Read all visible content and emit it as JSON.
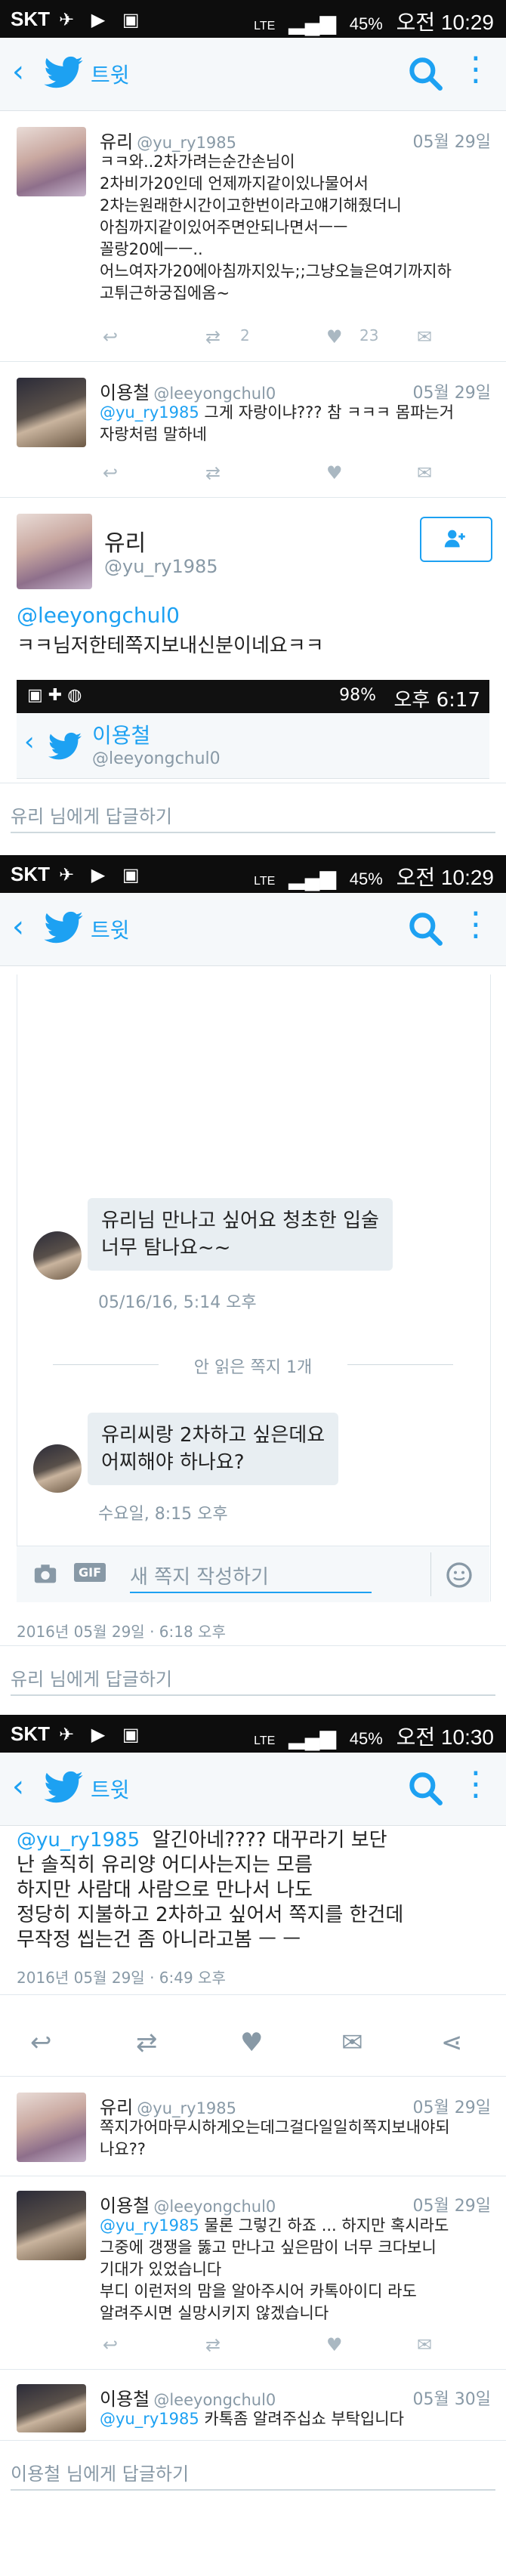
{
  "status1": {
    "carrier": "SKT",
    "battery": "45%",
    "time": "오전 10:29",
    "network": "LTE"
  },
  "status2": {
    "carrier": "SKT",
    "battery": "45%",
    "time": "오전 10:29",
    "network": "LTE"
  },
  "status3": {
    "carrier": "SKT",
    "battery": "45%",
    "time": "오전 10:30",
    "network": "LTE"
  },
  "inner_status": {
    "battery": "98%",
    "time": "오후 6:17"
  },
  "appbar": {
    "title": "트윗"
  },
  "sec1": {
    "tweet1": {
      "name": "유리",
      "handle": "@yu_ry1985",
      "date": "05월 29일",
      "text": "ㅋㅋ와..2차가려는순간손님이\n2차비가20인데 언제까지같이있나물어서\n2차는원래한시간이고한번이라고얘기해줬더니\n아침까지같이있어주면안되나면서ㅡㅡ\n꼴랑20에ㅡㅡ..\n어느여자가20에아침까지있누;;그냥오늘은여기까지하\n고튀근하궁집에옴~",
      "retweets": "2",
      "likes": "23"
    },
    "tweet2": {
      "name": "이용철",
      "handle": "@leeyongchul0",
      "date": "05월 29일",
      "text_mention": "@yu_ry1985",
      "text": " 그게 자랑이냐??? 참 ㅋㅋㅋ 몸파는거\n자랑처럼 말하네"
    },
    "dm_header": {
      "name": "유리",
      "handle": "@yu_ry1985"
    },
    "dm": {
      "mention": "@leeyongchul0",
      "text": "ㅋㅋ님저한테쪽지보내신분이네요ㅋㅋ"
    },
    "inner": {
      "name": "이용철",
      "handle": "@leeyongchul0"
    },
    "reply_placeholder": "유리 님에게 답글하기"
  },
  "sec2": {
    "msg1": {
      "text": "유리님 만나고 싶어요 청초한 입술\n너무 탐나요~~",
      "time": "05/16/16, 5:14 오후"
    },
    "unread": "안 읽은 쪽지 1개",
    "msg2": {
      "text": "유리씨랑 2차하고 싶은데요\n어찌해야 하나요?",
      "time": "수요일, 8:15 오후"
    },
    "compose_placeholder": "새 쪽지 작성하기",
    "gif_label": "GIF",
    "timestamp": "2016년 05월 29일 · 6:18 오후",
    "reply_placeholder": "유리 님에게 답글하기"
  },
  "sec3": {
    "main": {
      "mention": "@yu_ry1985",
      "text_first": "  알긴아네???? 대꾸라기 보단",
      "text": "난 솔직히 유리양 어디사는지는 모름\n하지만 사람대 사람으로 만나서 나도\n정당히 지불하고 2차하고 싶어서 쪽지를 한건데\n무작정 씹는건 좀 아니라고봄 ㅡ ㅡ",
      "timestamp": "2016년 05월 29일 · 6:49 오후"
    },
    "reply1": {
      "name": "유리",
      "handle": "@yu_ry1985",
      "date": "05월 29일",
      "text": "쪽지가어마무시하게오는데그걸다일일히쪽지보내야되\n나요??"
    },
    "reply2": {
      "name": "이용철",
      "handle": "@leeyongchul0",
      "date": "05월 29일",
      "mention": "@yu_ry1985",
      "text_first": " 물론 그렇긴 하죠 ... 하지만 혹시라도",
      "text": "그중에 갱쟁을 뚫고 만나고 싶은맘이 너무 크다보니\n기대가 있었습니다\n부디 이런저의 맘을 알아주시어 카톡아이디 라도\n알려주시면 실망시키지 않겠습니다"
    },
    "reply3": {
      "name": "이용철",
      "handle": "@leeyongchul0",
      "date": "05월 30일",
      "mention": "@yu_ry1985",
      "text": " 카톡좀 알려주십쇼 부탁입니다"
    },
    "reply_placeholder": "이용철 님에게 답글하기"
  },
  "colors": {
    "accent": "#1da1f2",
    "muted": "#8899a6",
    "statusbar": "#0d0d0d"
  },
  "icons": [
    "back-chevron-icon",
    "twitter-bird-icon",
    "search-icon",
    "kebab-menu-icon",
    "reply-icon",
    "retweet-icon",
    "like-icon",
    "dm-icon",
    "share-icon",
    "follow-icon",
    "camera-icon",
    "emoji-icon"
  ]
}
